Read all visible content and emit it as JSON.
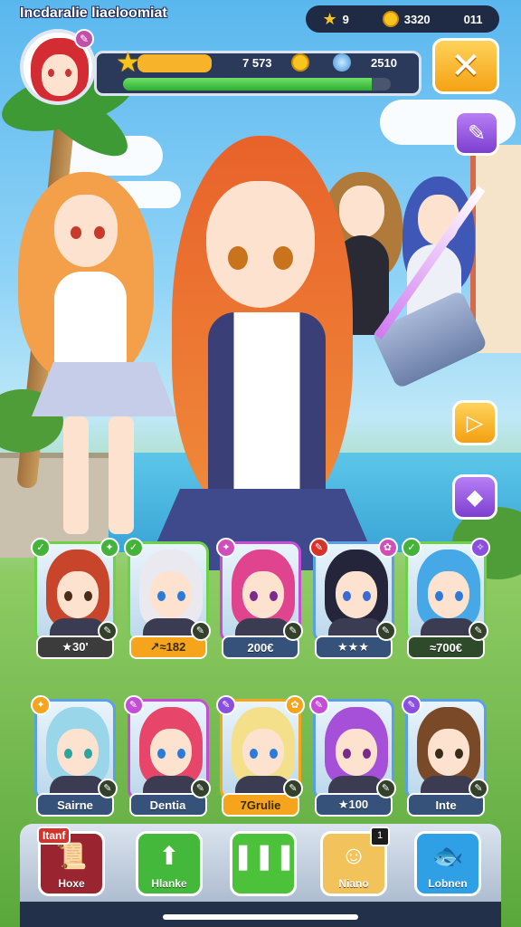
{
  "game_title": "Incdaralie liaeloomiat",
  "top_stats": {
    "star_value": "9",
    "coin_value": "3320",
    "extra_value": "011"
  },
  "player": {
    "avatar_badge": "✎",
    "xp_text": "7 573",
    "gem_value": "2510",
    "hp_fraction": 0.93
  },
  "colors": {
    "accent_yellow": "#f7b42a",
    "accent_purple": "#8b4fe0",
    "hp_green": "#2fae31"
  },
  "side_buttons": [
    {
      "icon": "eraser-icon",
      "glyph": "✎"
    },
    {
      "icon": "play-icon",
      "glyph": "▷"
    },
    {
      "icon": "diamond-icon",
      "glyph": "◆"
    }
  ],
  "roster_row1": [
    {
      "label": "★30'",
      "hair": "#c8442a",
      "eye": "#4a2d18",
      "frame": "#6dd24a",
      "plate": "#3c3c3c",
      "plate_light": false,
      "tl": "✓",
      "tl_color": "#43b33a",
      "tr": "✦",
      "tr_color": "#43b33a"
    },
    {
      "label": "↗≈182",
      "hair": "#e9e9ef",
      "eye": "#2e7ad8",
      "frame": "#6dd24a",
      "plate": "#f6a41c",
      "plate_light": true,
      "tl": "✓",
      "tl_color": "#43b33a",
      "tr": "",
      "tr_color": ""
    },
    {
      "label": "200€",
      "hair": "#e0448f",
      "eye": "#7a2a8a",
      "frame": "#c44fd6",
      "plate": "#37527a",
      "plate_light": false,
      "tl": "✦",
      "tl_color": "#d04fb8",
      "tr": "",
      "tr_color": ""
    },
    {
      "label": "★★★",
      "hair": "#24243a",
      "eye": "#3a6ad4",
      "frame": "#5aa0e8",
      "plate": "#37527a",
      "plate_light": false,
      "tl": "✎",
      "tl_color": "#d8332b",
      "tr": "✿",
      "tr_color": "#d04fb8"
    },
    {
      "label": "≈700€",
      "hair": "#47a8e8",
      "eye": "#2e7ad8",
      "frame": "#6dd24a",
      "plate": "#2f4a2a",
      "plate_light": false,
      "tl": "✓",
      "tl_color": "#43b33a",
      "tr": "✧",
      "tr_color": "#8b4fe0"
    }
  ],
  "roster_row2": [
    {
      "label": "Sairne",
      "hair": "#9ad6ea",
      "eye": "#2ea3a0",
      "frame": "#5aa0e8",
      "plate": "#37527a",
      "plate_light": false,
      "tl": "✦",
      "tl_color": "#f6a41c",
      "tr": "",
      "tr_color": ""
    },
    {
      "label": "Dentia",
      "hair": "#e8456a",
      "eye": "#2e7ad8",
      "frame": "#c44fd6",
      "plate": "#37527a",
      "plate_light": false,
      "tl": "✎",
      "tl_color": "#c44fd6",
      "tr": "",
      "tr_color": ""
    },
    {
      "label": "7Grulie",
      "hair": "#f4e08a",
      "eye": "#2e7ad8",
      "frame": "#f6a41c",
      "plate": "#f6a41c",
      "plate_light": true,
      "tl": "✎",
      "tl_color": "#8b4fe0",
      "tr": "✿",
      "tr_color": "#f6a41c"
    },
    {
      "label": "★100",
      "hair": "#a64fd8",
      "eye": "#7a2a8a",
      "frame": "#5aa0e8",
      "plate": "#37527a",
      "plate_light": false,
      "tl": "✎",
      "tl_color": "#c44fd6",
      "tr": "",
      "tr_color": ""
    },
    {
      "label": "Inte",
      "hair": "#7a4a28",
      "eye": "#3a2a18",
      "frame": "#5aa0e8",
      "plate": "#37527a",
      "plate_light": false,
      "tl": "✎",
      "tl_color": "#8b4fe0",
      "tr": "",
      "tr_color": ""
    }
  ],
  "nav": [
    {
      "label": "Hoxe",
      "tag": "Itanf",
      "icon": "scroll-icon",
      "glyph": "📜",
      "color": "#9a2530"
    },
    {
      "label": "Hlanke",
      "tag": "",
      "icon": "boot-icon",
      "glyph": "⬆",
      "color": "#44b83b"
    },
    {
      "label": "",
      "tag": "",
      "icon": "pause-icon",
      "glyph": "❚❚❚",
      "color": "#4cc23a"
    },
    {
      "label": "Niano",
      "tag": "",
      "icon": "character-icon",
      "glyph": "☺",
      "color": "#f2c35a",
      "count": "1"
    },
    {
      "label": "Lobnen",
      "tag": "",
      "icon": "fish-icon",
      "glyph": "🐟",
      "color": "#2f9fe6"
    }
  ]
}
